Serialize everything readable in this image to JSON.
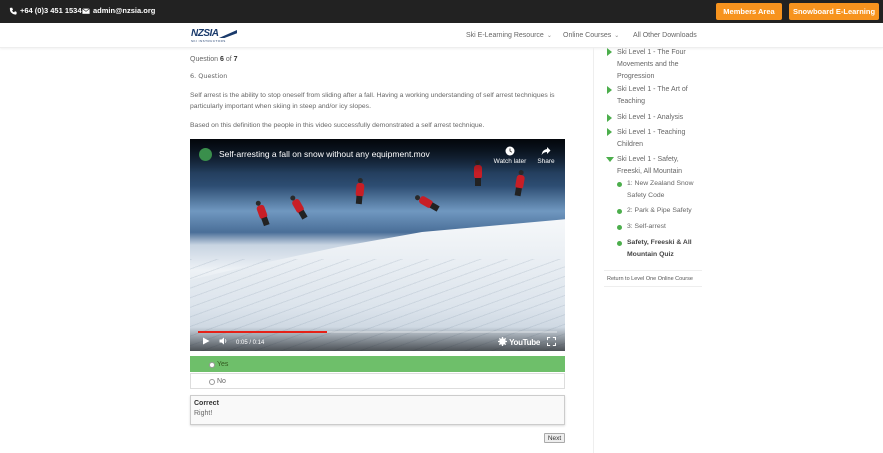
{
  "topbar": {
    "phone": "+64 (0)3 451 1534",
    "email": "admin@nzsia.org",
    "members_area": "Members Area",
    "snowboard_elearning": "Snowboard E-Learning"
  },
  "header": {
    "logo_text": "NZSIA",
    "logo_sub": "SKI INSTRUCTORS",
    "nav": [
      "Ski E-Learning Resource",
      "Online Courses",
      "All Other Downloads"
    ]
  },
  "quiz": {
    "question_prefix": "Question",
    "question_current": "6",
    "question_of": "of",
    "question_total": "7",
    "question_label": "6. Question",
    "paragraph1": "Self arrest is the ability to stop oneself from sliding after a fall. Having a working understanding of self arrest techniques is particularly important when skiing in steep and/or icy slopes.",
    "paragraph2": "Based on this definition the people in this video successfully demonstrated a self arrest technique.",
    "video": {
      "title": "Self-arresting a fall on snow without any equipment.mov",
      "watch_later": "Watch later",
      "share": "Share",
      "time": "0:05 / 0:14",
      "progress": 0.36,
      "brand": "YouTube"
    },
    "answers": [
      {
        "label": "Yes",
        "correct": true
      },
      {
        "label": "No",
        "correct": false
      }
    ],
    "response_title": "Correct",
    "response_message": "Right!",
    "next_label": "Next"
  },
  "sidebar": {
    "lessons": [
      {
        "label": "Ski Level 1 - The Four Movements and the Progression"
      },
      {
        "label": "Ski Level 1 - The Art of Teaching"
      },
      {
        "label": "Ski Level 1 - Analysis"
      },
      {
        "label": "Ski Level 1 - Teaching Children"
      },
      {
        "label": "Ski Level 1 - Safety, Freeski, All Mountain"
      }
    ],
    "topics": [
      {
        "label": "1: New Zealand Snow Safety Code"
      },
      {
        "label": "2: Park & Pipe Safety"
      },
      {
        "label": "3: Self-arrest"
      },
      {
        "label": "Safety, Freeski & All Mountain Quiz"
      }
    ],
    "return_link": "Return to Level One Online Course"
  },
  "colors": {
    "accent_orange": "#f7931e",
    "green": "#4cae4c",
    "correct_bg": "#6ebf6a",
    "topbar_bg": "#222222"
  }
}
